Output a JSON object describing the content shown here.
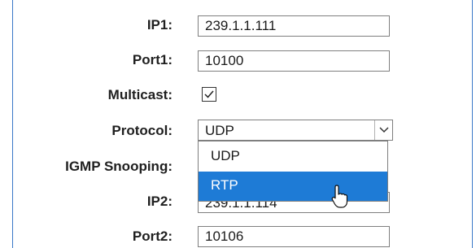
{
  "form": {
    "ip1": {
      "label": "IP1:",
      "value": "239.1.1.111"
    },
    "port1": {
      "label": "Port1:",
      "value": "10100"
    },
    "multicast": {
      "label": "Multicast:",
      "checked": true
    },
    "protocol": {
      "label": "Protocol:",
      "selected": "UDP",
      "open": true,
      "options": [
        "UDP",
        "RTP"
      ],
      "highlighted": "RTP"
    },
    "igmp": {
      "label": "IGMP Snooping:"
    },
    "ip2": {
      "label": "IP2:",
      "value": "239.1.1.114"
    },
    "port2": {
      "label": "Port2:",
      "value": "10106"
    }
  },
  "colors": {
    "accent_border": "#3a78c8",
    "highlight": "#1e7bd6"
  },
  "icons": {
    "checkbox": "checkmark-icon",
    "dropdown": "chevron-down-icon",
    "cursor": "mouse-pointer-icon"
  }
}
